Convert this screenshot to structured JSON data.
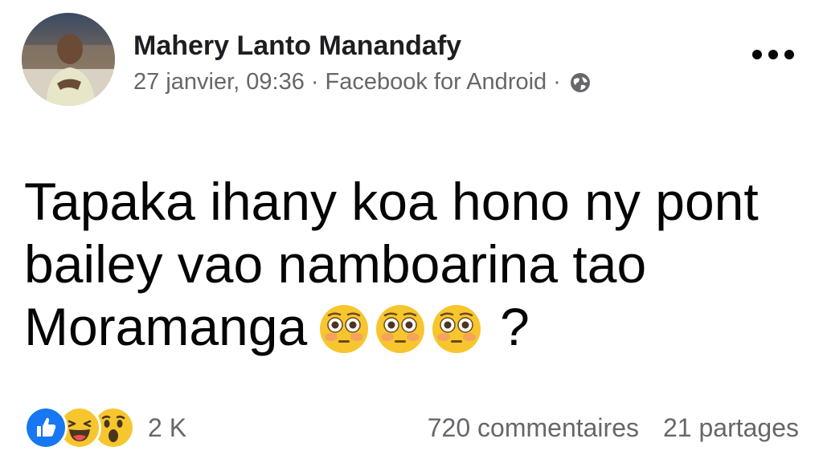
{
  "post": {
    "author": "Mahery Lanto Manandafy",
    "timestamp": "27 janvier, 09:36",
    "source": "Facebook for Android",
    "privacy_icon": "globe-icon",
    "more_icon": "more-options-icon",
    "text_line1": "Tapaka ihany koa hono ny pont",
    "text_line2": "bailey vao namboarina tao",
    "text_line3": "Moramanga",
    "text_end": "?",
    "emoji_icon": "flushed-face-emoji",
    "emoji_count": 3
  },
  "footer": {
    "reaction_icons": [
      "like-icon",
      "haha-icon",
      "wow-icon"
    ],
    "reaction_count": "2 K",
    "comments": "720 commentaires",
    "shares": "21 partages"
  },
  "colors": {
    "text_primary": "#050505",
    "text_secondary": "#65676b",
    "like_blue": "#1877f2",
    "emoji_yellow": "#f7b125"
  }
}
